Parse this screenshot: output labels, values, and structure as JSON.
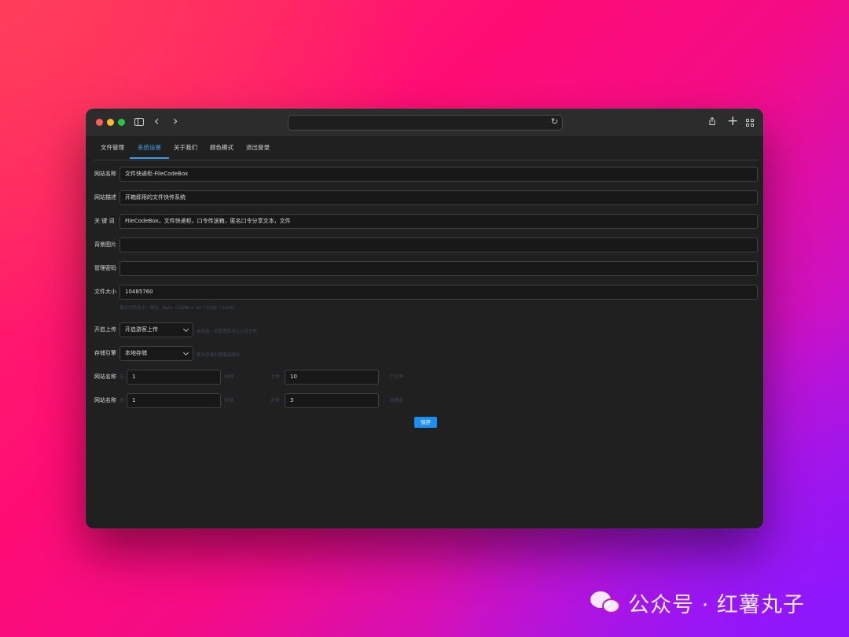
{
  "browser": {
    "address": "",
    "icons": [
      "sidebar-toggle-icon",
      "chevron-left-icon",
      "chevron-right-icon",
      "reload-icon",
      "share-icon",
      "plus-icon",
      "tabs-overview-icon"
    ]
  },
  "tabs": [
    {
      "label": "文件管理"
    },
    {
      "label": "系统设置"
    },
    {
      "label": "关于我们"
    },
    {
      "label": "颜色模式"
    },
    {
      "label": "退出登录"
    }
  ],
  "active_tab": "系统设置",
  "accent_color": "#3d9be9",
  "form": {
    "site_name": {
      "label": "网站名称",
      "value": "文件快递柜-FileCodeBox"
    },
    "site_desc": {
      "label": "网站描述",
      "value": "开箱即用的文件快传系统"
    },
    "keywords": {
      "label": "关 键 词",
      "value": "FileCodeBox，文件快递柜，口令传送箱，匿名口令分享文本，文件"
    },
    "background": {
      "label": "背景图片",
      "value": ""
    },
    "admin_password": {
      "label": "管理密码",
      "value": ""
    },
    "file_size": {
      "label": "文件大小",
      "value": "10485760",
      "hint": "最大文件大小，单位：Byte（10MB = 10 * 1024 * 1024）"
    },
    "upload": {
      "label": "开启上传",
      "value": "开启游客上传",
      "hint": "关闭后，仅管理员可以上传文件"
    },
    "storage": {
      "label": "存储引擎",
      "value": "本地存储",
      "hint": "更多存储引擎敬请期待"
    },
    "rate_limit_upload": {
      "label": "网站名称",
      "prefix": "在",
      "minutes": "1",
      "unit1": "分钟",
      "middle": "上传",
      "count": "10",
      "unit2": "个文件"
    },
    "rate_limit_error": {
      "label": "网站名称",
      "prefix": "在",
      "minutes": "1",
      "unit1": "分钟",
      "middle": "允许",
      "count": "3",
      "unit2": "次错误"
    }
  },
  "save_label": "保存",
  "watermark": {
    "text": "公众号 · 红薯丸子"
  }
}
